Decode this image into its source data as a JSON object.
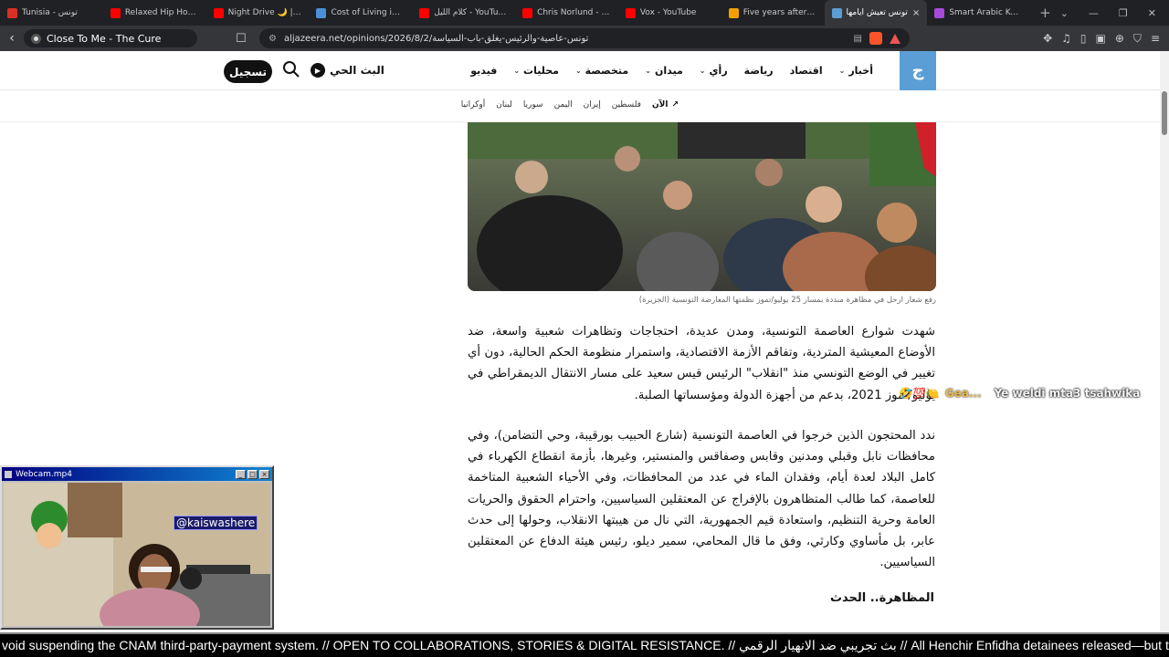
{
  "browser": {
    "tabs": [
      {
        "title": "Tunisia - تونس",
        "color": "#d93025"
      },
      {
        "title": "Relaxed Hip Hop & Ja...",
        "color": "#ff0000"
      },
      {
        "title": "Night Drive 🌙 | ﺔﺒﻗﺭ",
        "color": "#ff0000"
      },
      {
        "title": "Cost of Living in Djerb...",
        "color": "#4a90d9"
      },
      {
        "title": "كلام الليل - YouTube",
        "color": "#ff0000"
      },
      {
        "title": "Chris Norlund - YouTu...",
        "color": "#ff0000"
      },
      {
        "title": "Vox - YouTube",
        "color": "#ff0000"
      },
      {
        "title": "Five years after Saied...",
        "color": "#f29f05"
      },
      {
        "title": "تونس تعيش أيامها",
        "color": "#5b9ed6",
        "active": true
      },
      {
        "title": "Smart Arabic Keyboa...",
        "color": "#a64ad9"
      }
    ],
    "new_tab": "+",
    "media_title": "Close To Me - The Cure",
    "url": "aljazeera.net/opinions/2026/8/2/تونس-عاصية-والرئيس-يغلق-باب-السياسة"
  },
  "site": {
    "logo": "ج",
    "nav": [
      {
        "label": "أخبار",
        "dropdown": true
      },
      {
        "label": "اقتصاد",
        "dropdown": false
      },
      {
        "label": "رياضة",
        "dropdown": false
      },
      {
        "label": "رأي",
        "dropdown": true
      },
      {
        "label": "ميدان",
        "dropdown": true
      },
      {
        "label": "متخصصة",
        "dropdown": true
      },
      {
        "label": "محليات",
        "dropdown": true
      },
      {
        "label": "فيديو",
        "dropdown": false
      }
    ],
    "live_label": "البث الحي",
    "signup_label": "تسجيل",
    "now_label": "الآن",
    "trending": [
      "فلسطين",
      "إيران",
      "اليمن",
      "سوريا",
      "لبنان",
      "أوكرانيا"
    ]
  },
  "article": {
    "caption": "رفع شعار ارحل في مظاهرة منددة بمسار 25 يوليو/تموز نظمتها المعارضة التونسية (الجزيرة)",
    "para1": "شهدت شوارع العاصمة التونسية، ومدن عديدة، احتجاجات وتظاهرات شعبية واسعة، ضد الأوضاع المعيشية المتردية، وتفاقم الأزمة الاقتصادية، واستمرار منظومة الحكم الحالية، دون أي تغيير في الوضع التونسي منذ \"انقلاب\" الرئيس قيس سعيد على مسار الانتقال الديمقراطي في يوليو/تموز 2021، بدعم من أجهزة الدولة ومؤسساتها الصلبة.",
    "para2": "ندد المحتجون الذين خرجوا في العاصمة التونسية (شارع الحبيب بورقيبة، وحي التضامن)، وفي محافظات نابل وقبلي ومدنين وقابس وصفاقس والمنستير، وغيرها، بأزمة انقطاع الكهرباء في كامل البلاد لعدة أيام، وفقدان الماء في عدد من المحافظات، وفي الأحياء الشعبية المتاخمة للعاصمة، كما طالب المتظاهرون بالإفراج عن المعتقلين السياسيين، واحترام الحقوق والحريات العامة وحرية التنظيم، واستعادة قيم الجمهورية، التي نال من هيبتها الانقلاب، وحولها إلى حدث عابر، بل مأساوي وكارثي، وفق ما قال المحامي، سمير ديلو، رئيس هيئة الدفاع عن المعتقلين السياسيين.",
    "subhead": "المظاهرة.. الحدث"
  },
  "overlay": {
    "chat_user": "Gea...",
    "chat_message": "Ye weldi mta3 tsahwika",
    "webcam_title": "Webcam.mp4",
    "handle": "@kaiswashere",
    "ticker": "void suspending the CNAM third-party-payment system. // OPEN TO COLLABORATIONS, STORIES & DIGITAL RESISTANCE. // بث تجريبي ضد الانهيار الرقمي // All Henchir Enfidha detainees released—but the"
  }
}
